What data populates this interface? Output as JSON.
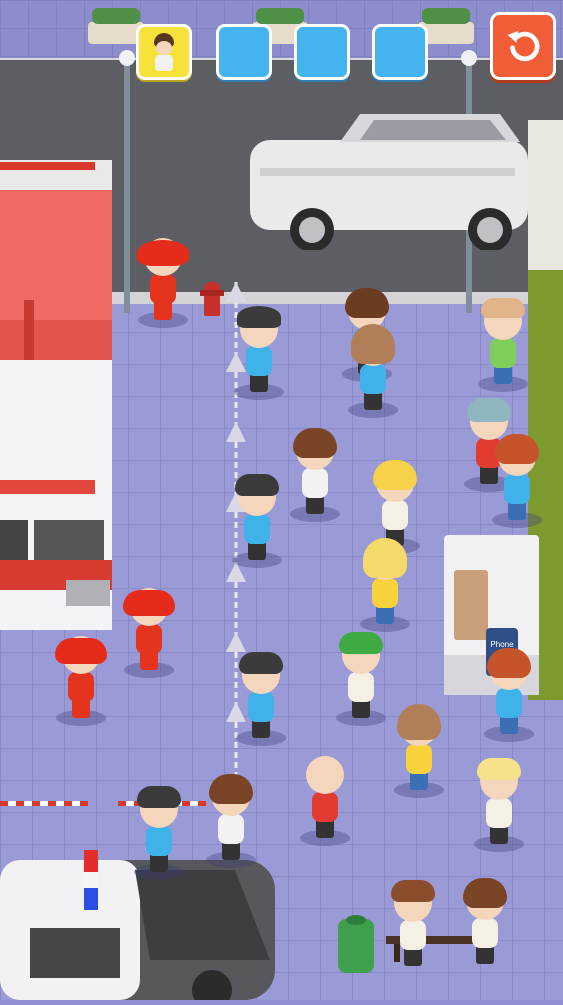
{
  "hud": {
    "slots": [
      {
        "state": "filled",
        "content": "curly-hair-person-icon"
      },
      {
        "state": "empty"
      },
      {
        "state": "empty"
      },
      {
        "state": "empty"
      }
    ],
    "restart_icon": "restart-arrow-icon"
  },
  "scene": {
    "phone_booth_label": "Phone"
  },
  "colors": {
    "slot_empty": "#43b4ee",
    "slot_filled": "#f7e23a",
    "restart": "#f05d36",
    "firefighter": "#e4341d",
    "police": "#3b3b3b",
    "plaza": "#9a9ad6",
    "road": "#5d5e63"
  }
}
